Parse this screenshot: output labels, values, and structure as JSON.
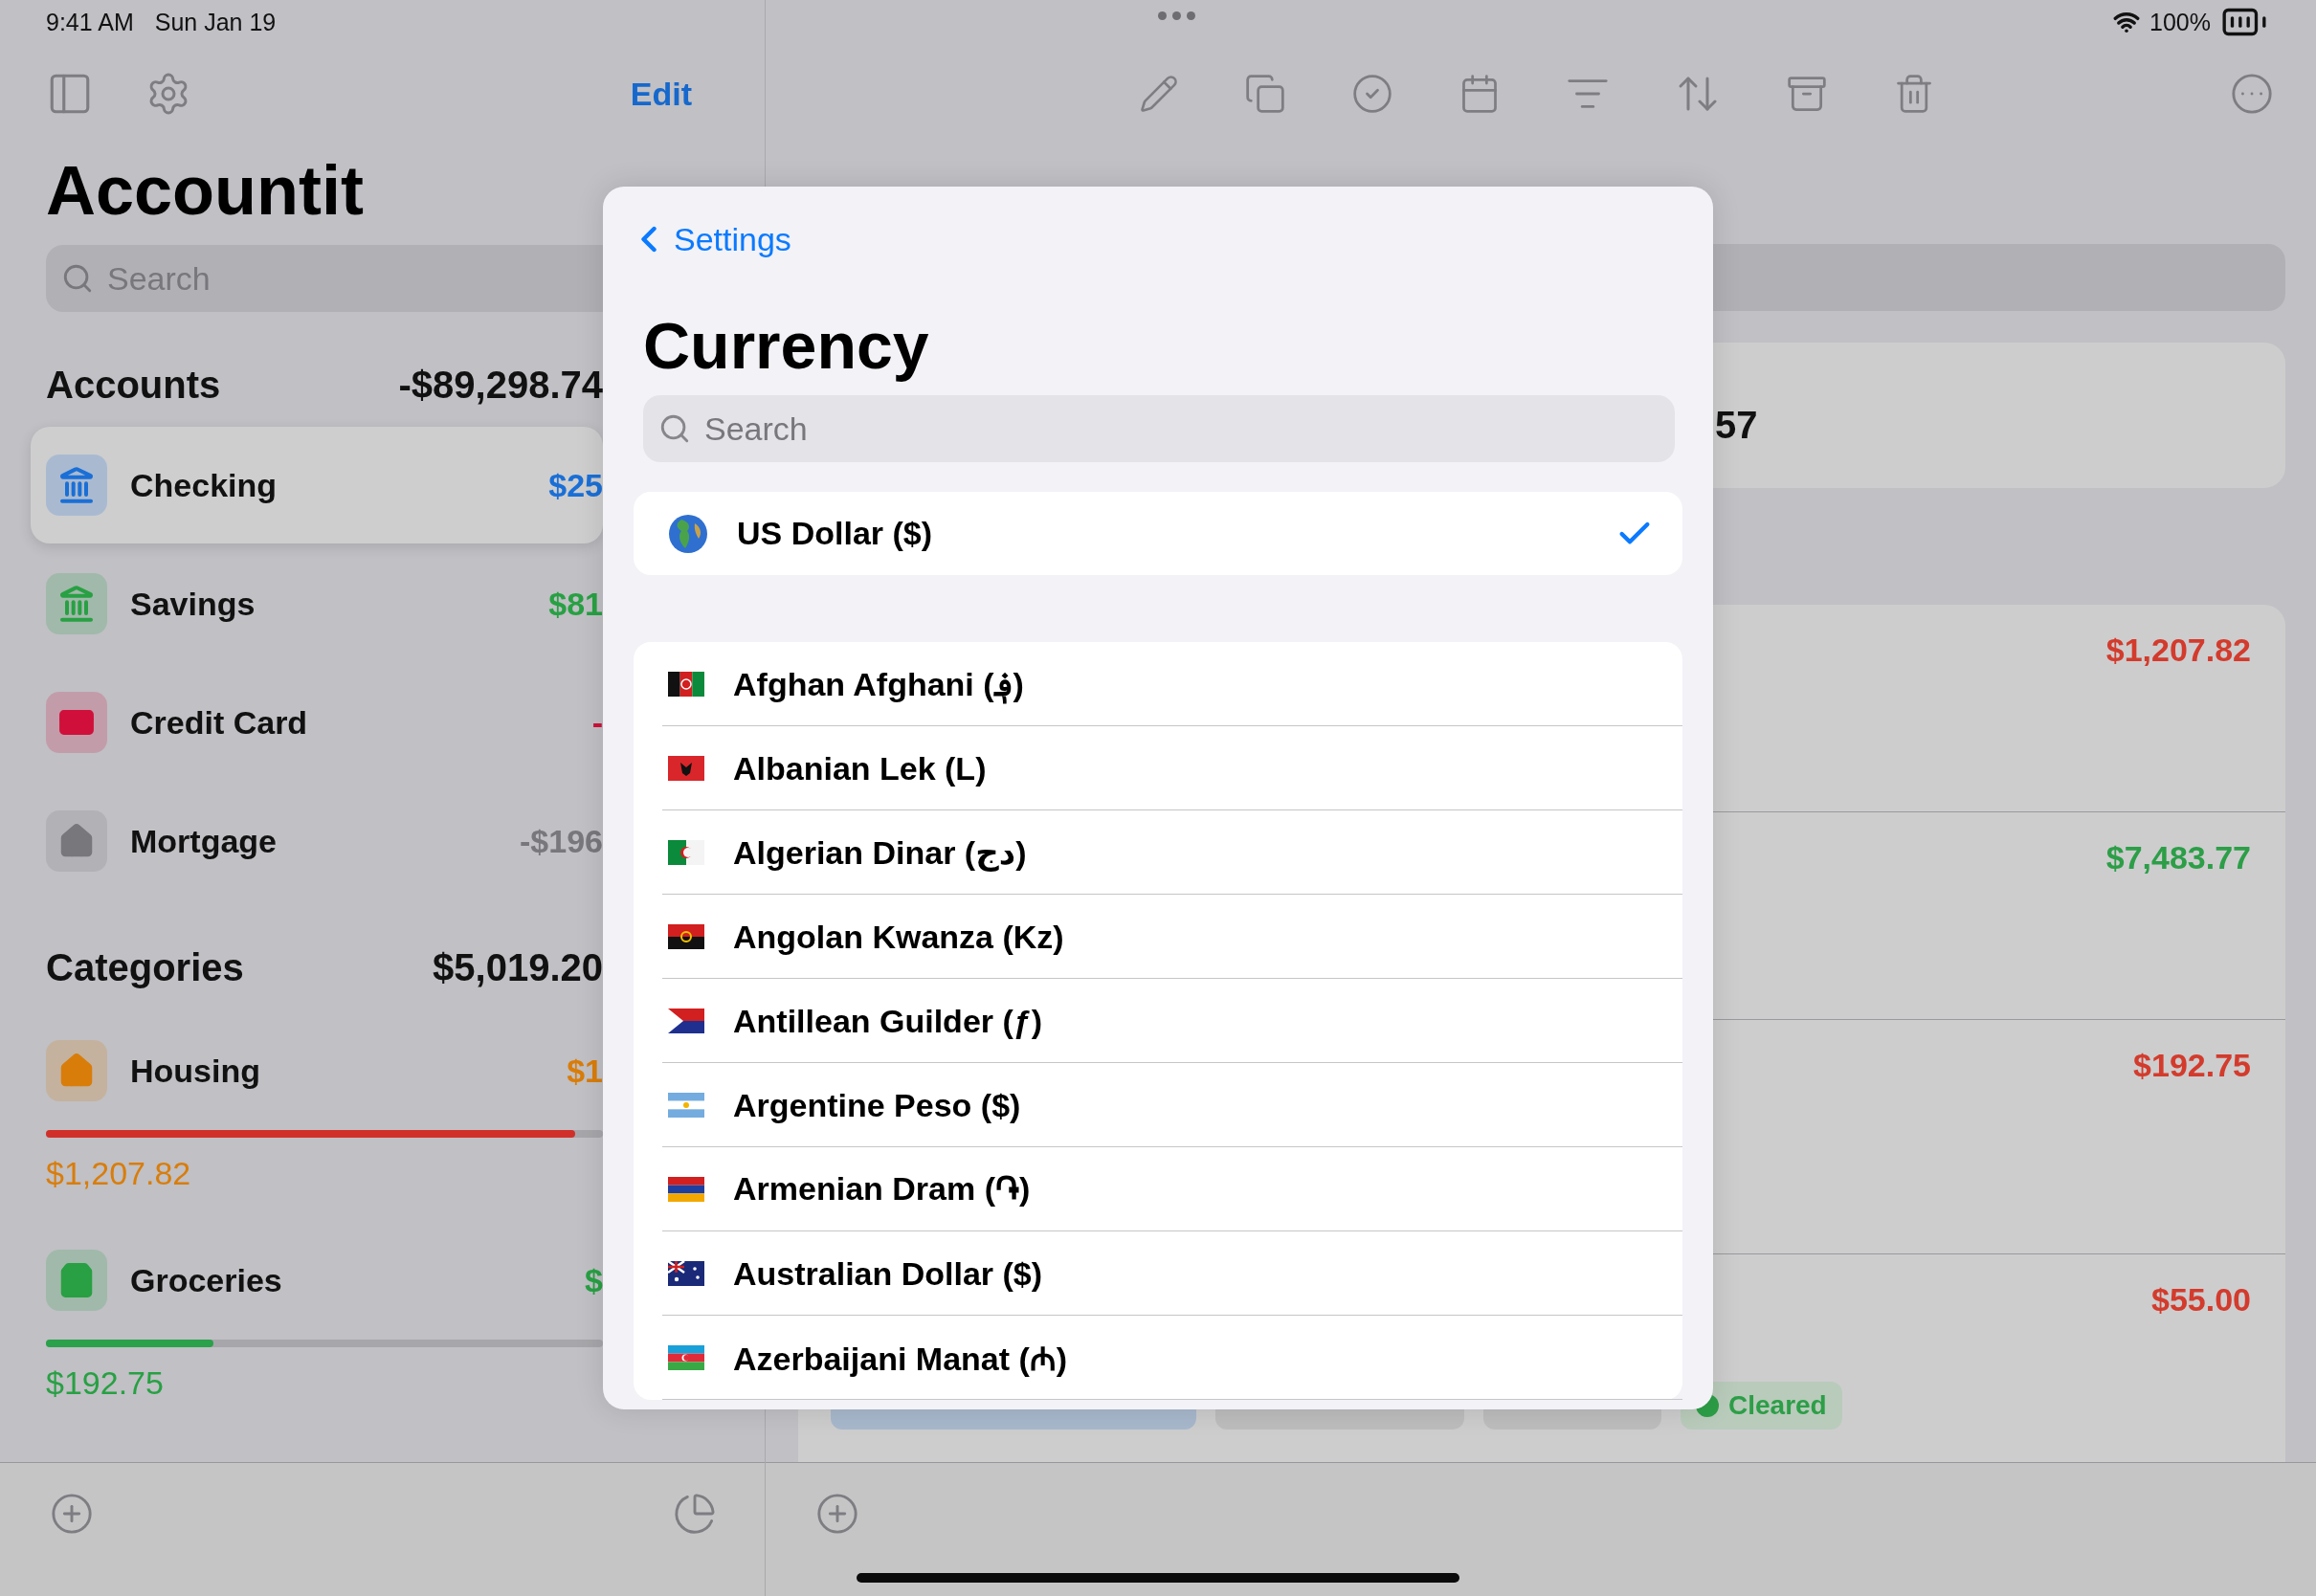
{
  "status_bar": {
    "time": "9:41 AM",
    "date": "Sun Jan 19",
    "battery": "100%"
  },
  "sidebar": {
    "edit": "Edit",
    "title": "Accountit",
    "search": {
      "placeholder": "Search"
    },
    "accounts": {
      "label": "Accounts",
      "total": "-$89,298.74",
      "items": [
        {
          "name": "Checking",
          "amount": "$25",
          "kind": "bank",
          "color": "#1a6fd6",
          "selected": true
        },
        {
          "name": "Savings",
          "amount": "$81",
          "kind": "bank",
          "color": "#28a043",
          "selected": false
        },
        {
          "name": "Credit Card",
          "amount": "-",
          "kind": "card",
          "color": "#d0103a",
          "selected": false
        },
        {
          "name": "Mortgage",
          "amount": "-$196",
          "kind": "home",
          "color": "#77777c",
          "selected": false
        }
      ]
    },
    "categories": {
      "label": "Categories",
      "total": "$5,019.20",
      "items": [
        {
          "name": "Housing",
          "amount": "$1",
          "kind": "home",
          "color": "#d97d0a",
          "level": 0.95,
          "over_budget": true,
          "spent": "$1,207.82"
        },
        {
          "name": "Groceries",
          "amount": "$",
          "kind": "bag",
          "color": "#28a043",
          "level": 0.3,
          "over_budget": false,
          "spent": "$192.75"
        }
      ]
    }
  },
  "detail": {
    "summary": "57",
    "transactions": [
      {
        "amount": "$1,207.82",
        "income": false
      },
      {
        "amount": "$7,483.77",
        "income": true
      },
      {
        "amount": "$192.75",
        "income": false
      },
      {
        "amount": "$55.00",
        "income": false,
        "tags": [
          {
            "label": "Cleared"
          }
        ]
      }
    ]
  },
  "modal": {
    "back": "Settings",
    "title": "Currency",
    "search": {
      "placeholder": "Search"
    },
    "current": {
      "name": "US Dollar ($)",
      "selected": true
    },
    "currencies": [
      {
        "name": "Afghan Afghani (؋)",
        "selected": false
      },
      {
        "name": "Albanian Lek (L)",
        "selected": false
      },
      {
        "name": "Algerian Dinar (دج)",
        "selected": false
      },
      {
        "name": "Angolan Kwanza (Kz)",
        "selected": false
      },
      {
        "name": "Antillean Guilder (ƒ)",
        "selected": false
      },
      {
        "name": "Argentine Peso ($)",
        "selected": false
      },
      {
        "name": "Armenian Dram (֏)",
        "selected": false
      },
      {
        "name": "Australian Dollar ($)",
        "selected": false
      },
      {
        "name": "Azerbaijani Manat (₼)",
        "selected": false
      }
    ]
  }
}
